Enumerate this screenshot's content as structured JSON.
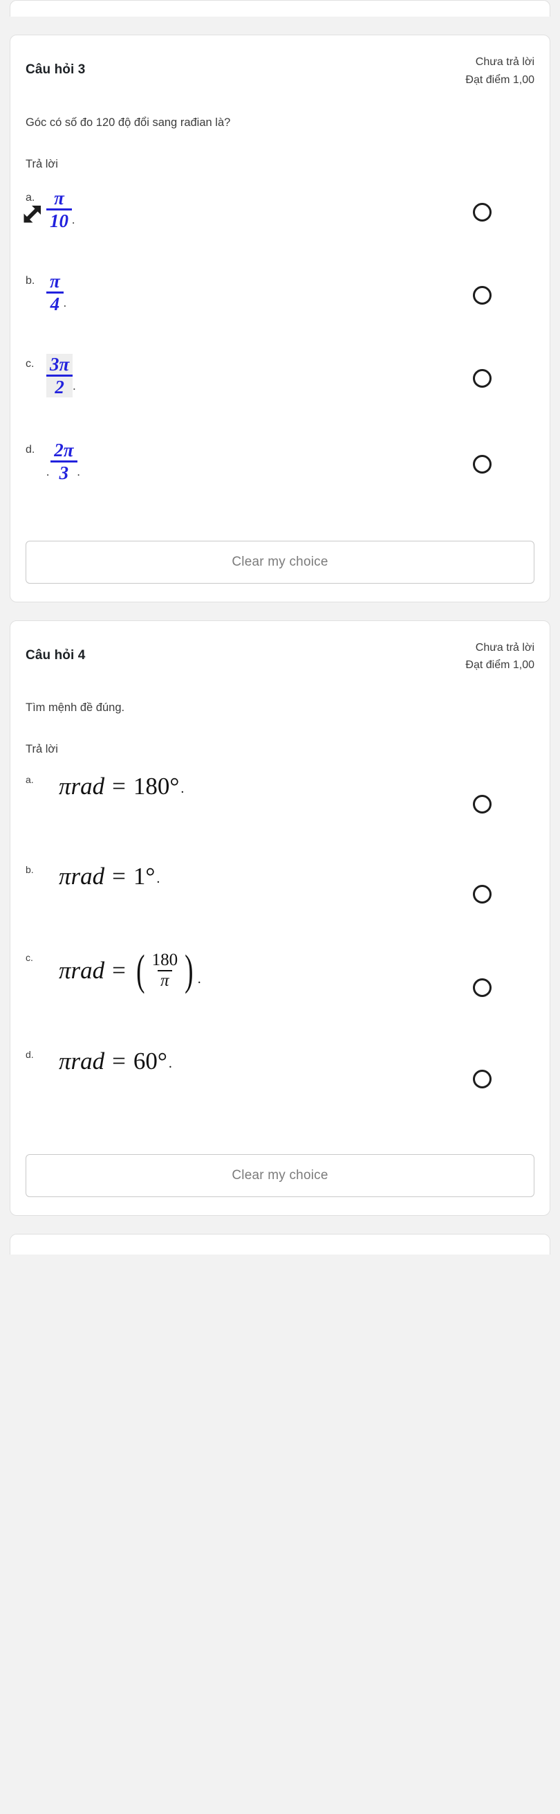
{
  "theme": {
    "page_background": "#f2f2f2",
    "card_background": "#ffffff",
    "card_border": "#e0e0e0",
    "text_primary": "#3c3c3c",
    "title_color": "#1d2125",
    "math_blue": "#2222dd",
    "button_text": "#7b7b7b",
    "highlight_background": "#eeeeee"
  },
  "questions": [
    {
      "title": "Câu hỏi 3",
      "status": "Chưa trả lời",
      "grade": "Đạt điểm 1,00",
      "stem": "Góc có số đo 120 độ  đổi sang rađian là?",
      "answer_label": "Trả lời",
      "clear_label": "Clear my choice",
      "options": [
        {
          "letter": "a.",
          "numerator": "π",
          "denominator": "10",
          "highlight": false,
          "lead_dot": false,
          "trail_dot": true
        },
        {
          "letter": "b.",
          "numerator": "π",
          "denominator": "4",
          "highlight": false,
          "lead_dot": false,
          "trail_dot": true
        },
        {
          "letter": "c.",
          "numerator": "3π",
          "denominator": "2",
          "highlight": true,
          "lead_dot": false,
          "trail_dot": true
        },
        {
          "letter": "d.",
          "numerator": "2π",
          "denominator": "3",
          "highlight": false,
          "lead_dot": true,
          "trail_dot": true
        }
      ]
    },
    {
      "title": "Câu hỏi 4",
      "status": "Chưa trả lời",
      "grade": "Đạt điểm 1,00",
      "stem": "Tìm mệnh đề đúng.",
      "answer_label": "Trả lời",
      "clear_label": "Clear my choice",
      "options": [
        {
          "letter": "a.",
          "lhs": "πrad",
          "relation": "=",
          "rhs": "180°",
          "kind": "plain",
          "trail_dot": true
        },
        {
          "letter": "b.",
          "lhs": "πrad",
          "relation": "=",
          "rhs": "1°",
          "kind": "plain",
          "trail_dot": true
        },
        {
          "letter": "c.",
          "lhs": "πrad",
          "relation": "=",
          "rhs_numerator": "180",
          "rhs_denominator": "π",
          "kind": "parenthesized-fraction",
          "trail_dot": true
        },
        {
          "letter": "d.",
          "lhs": "πrad",
          "relation": "=",
          "rhs": "60°",
          "kind": "plain",
          "trail_dot": true
        }
      ]
    }
  ],
  "cursor": {
    "icon": "resize-nesw-cursor"
  }
}
